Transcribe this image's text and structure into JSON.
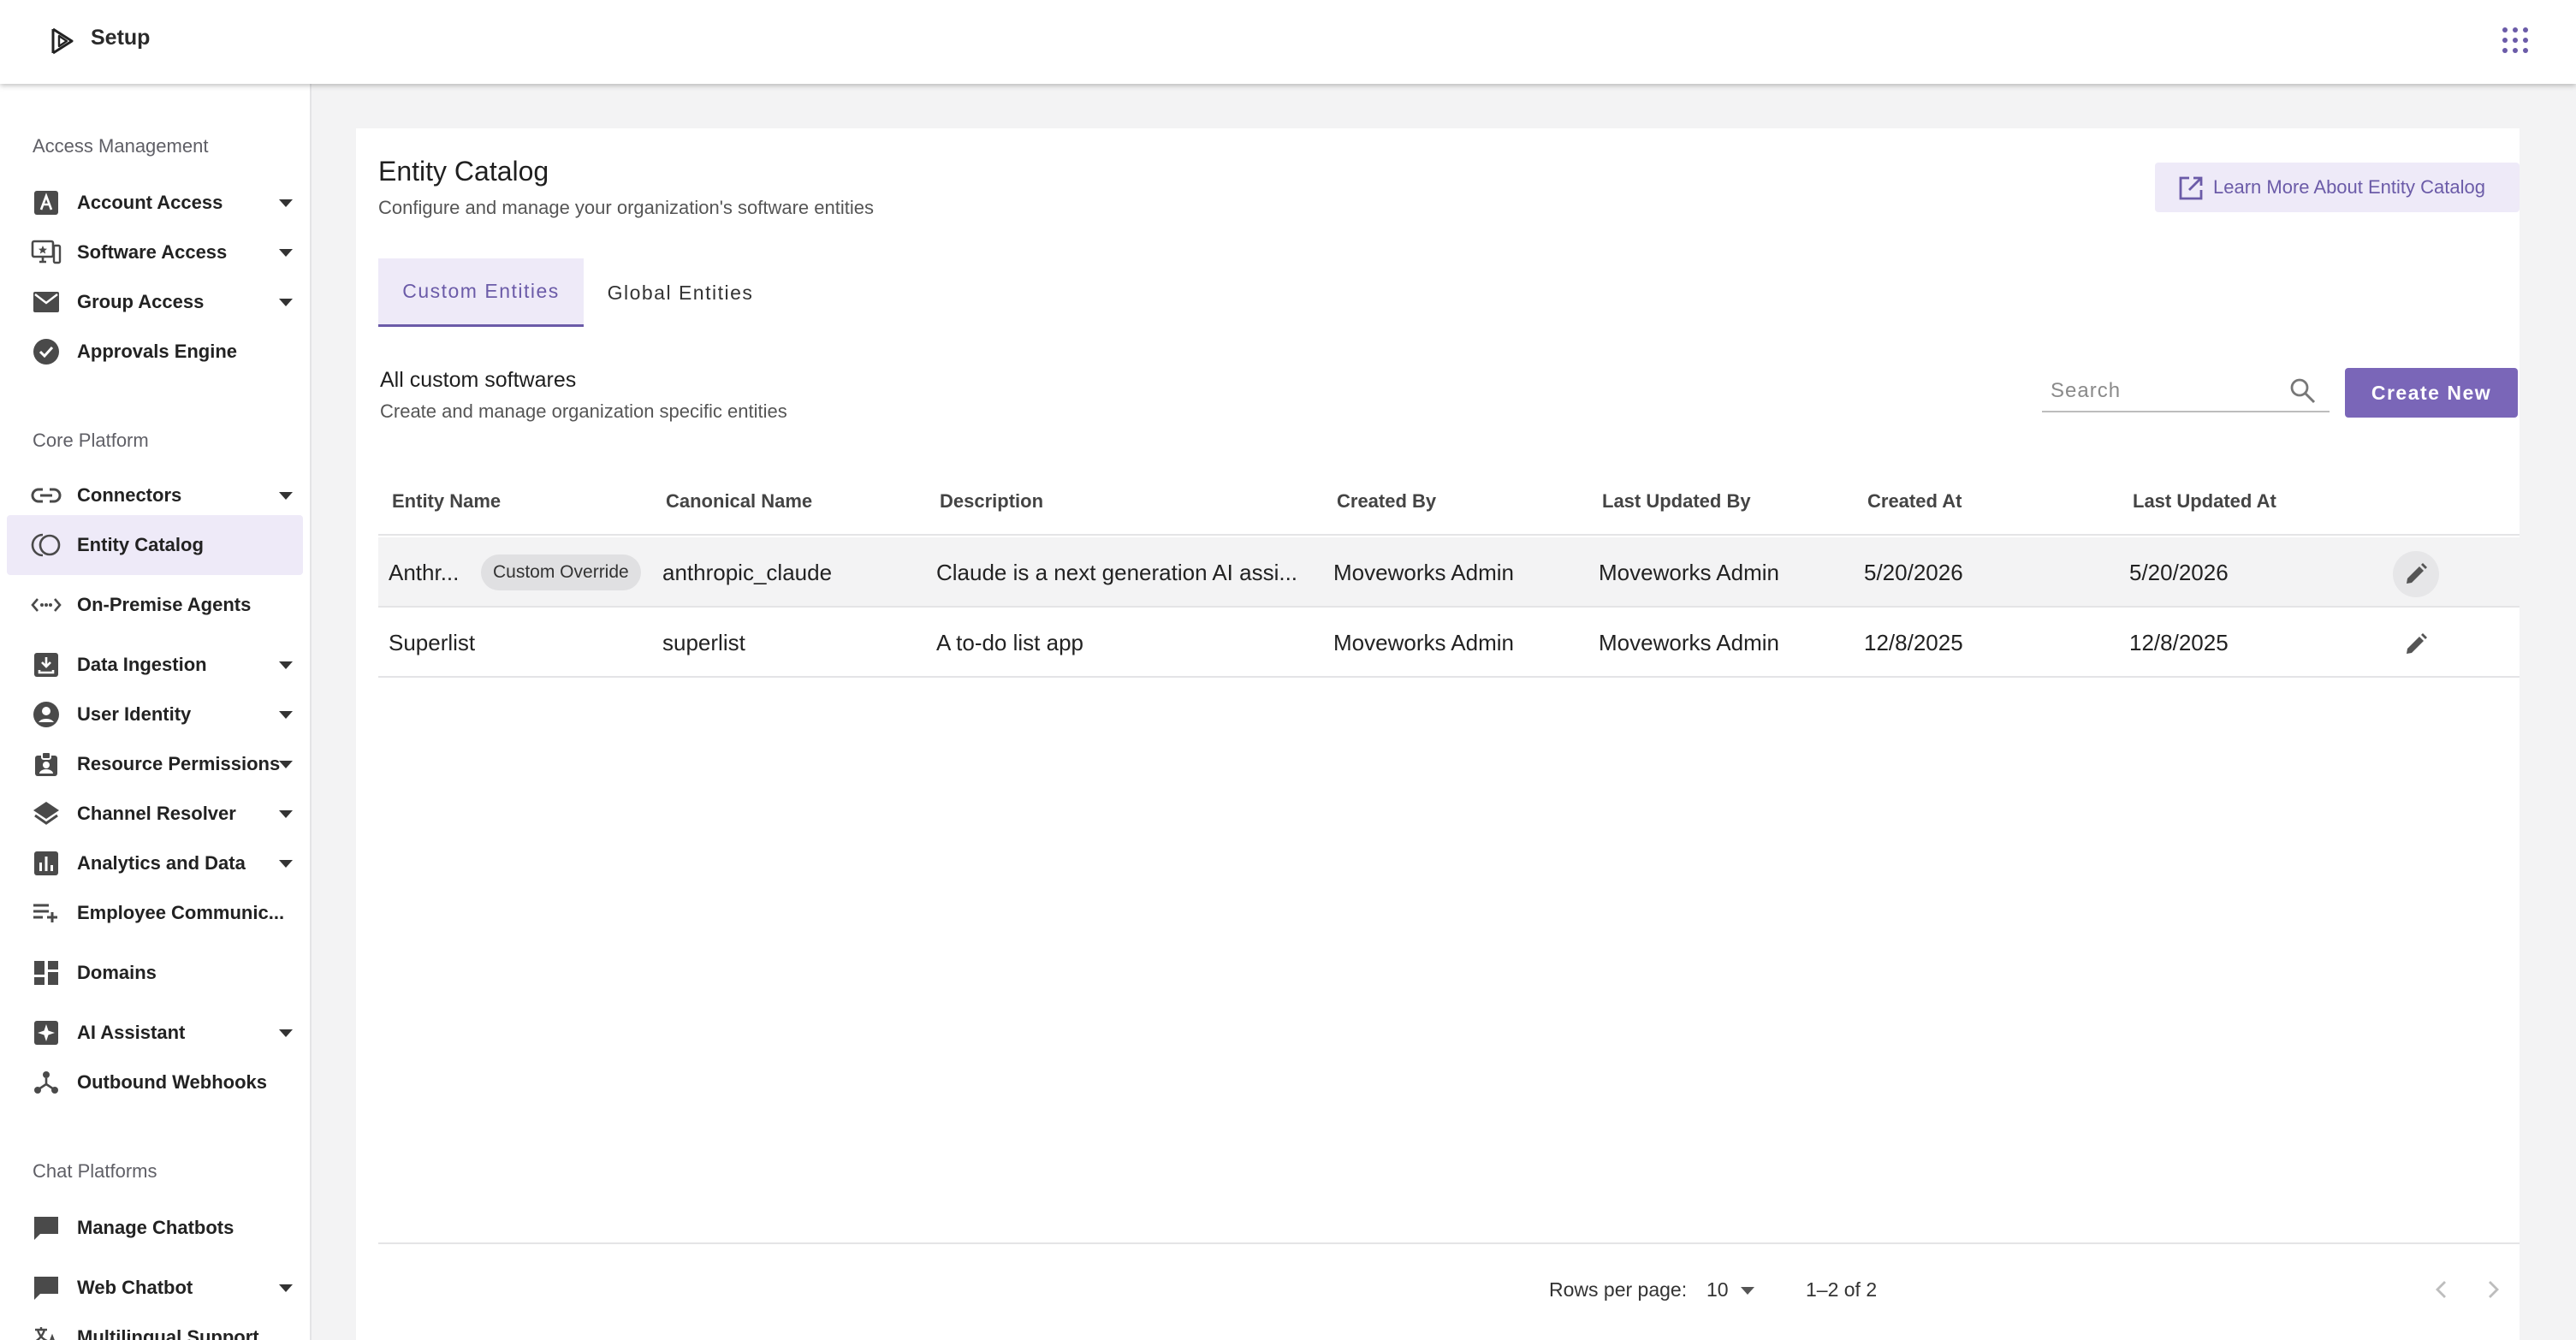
{
  "app": {
    "title": "Setup",
    "accent_color": "#6b5ba8"
  },
  "sidebar": {
    "sections": [
      {
        "label": "Access Management",
        "items": [
          {
            "label": "Account Access",
            "icon": "account-a-icon",
            "expandable": true
          },
          {
            "label": "Software Access",
            "icon": "software-desktop-icon",
            "expandable": true
          },
          {
            "label": "Group Access",
            "icon": "mail-icon",
            "expandable": true
          },
          {
            "label": "Approvals Engine",
            "icon": "check-circle-icon",
            "expandable": false
          }
        ]
      },
      {
        "label": "Core Platform",
        "items": [
          {
            "label": "Connectors",
            "icon": "link-icon",
            "expandable": true
          },
          {
            "label": "Entity Catalog",
            "icon": "entity-catalog-icon",
            "expandable": false,
            "active": true
          },
          {
            "label": "On-Premise Agents",
            "icon": "code-dots-icon",
            "expandable": false
          },
          {
            "label": "Data Ingestion",
            "icon": "download-box-icon",
            "expandable": true
          },
          {
            "label": "User Identity",
            "icon": "account-circle-icon",
            "expandable": true
          },
          {
            "label": "Resource Permissions",
            "icon": "badge-icon",
            "expandable": true
          },
          {
            "label": "Channel Resolver",
            "icon": "layers-icon",
            "expandable": true
          },
          {
            "label": "Analytics and Data",
            "icon": "bar-chart-icon",
            "expandable": true
          },
          {
            "label": "Employee Communic...",
            "icon": "playlist-add-icon",
            "expandable": false
          },
          {
            "label": "Domains",
            "icon": "dashboard-icon",
            "expandable": false
          },
          {
            "label": "AI Assistant",
            "icon": "sparkle-box-icon",
            "expandable": true
          },
          {
            "label": "Outbound Webhooks",
            "icon": "webhook-icon",
            "expandable": false
          }
        ]
      },
      {
        "label": "Chat Platforms",
        "items": [
          {
            "label": "Manage Chatbots",
            "icon": "chat-bubble-icon",
            "expandable": false
          },
          {
            "label": "Web Chatbot",
            "icon": "chat-bubble-icon",
            "expandable": true
          },
          {
            "label": "Multilingual Support",
            "icon": "translate-icon",
            "expandable": false
          }
        ]
      }
    ]
  },
  "page": {
    "title": "Entity Catalog",
    "subtitle": "Configure and manage your organization's software entities",
    "learn_more_label": "Learn More About Entity Catalog"
  },
  "tabs": [
    {
      "label": "Custom Entities",
      "active": true
    },
    {
      "label": "Global Entities",
      "active": false
    }
  ],
  "list": {
    "title": "All custom softwares",
    "subtitle": "Create and manage organization specific entities",
    "search_placeholder": "Search",
    "create_label": "Create New"
  },
  "table": {
    "columns": [
      "Entity Name",
      "Canonical Name",
      "Description",
      "Created By",
      "Last Updated By",
      "Created At",
      "Last Updated At"
    ],
    "rows": [
      {
        "entity_name": "Anthr...",
        "badge": "Custom Override",
        "canonical_name": "anthropic_claude",
        "description": "Claude is a next generation AI assi...",
        "created_by": "Moveworks Admin",
        "last_updated_by": "Moveworks Admin",
        "created_at": "5/20/2026",
        "last_updated_at": "5/20/2026"
      },
      {
        "entity_name": "Superlist",
        "badge": "",
        "canonical_name": "superlist",
        "description": "A to-do list app",
        "created_by": "Moveworks Admin",
        "last_updated_by": "Moveworks Admin",
        "created_at": "12/8/2025",
        "last_updated_at": "12/8/2025"
      }
    ]
  },
  "pagination": {
    "rows_per_page_label": "Rows per page:",
    "rows_per_page": "10",
    "range": "1–2 of 2"
  }
}
